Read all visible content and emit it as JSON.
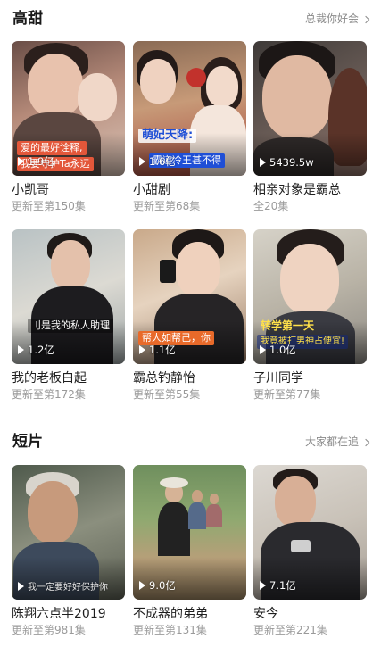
{
  "sections": [
    {
      "title": "高甜",
      "more": "总裁你好会",
      "items": [
        {
          "title": "小凯哥",
          "sub": "更新至第150集",
          "views": "1.9亿",
          "caption": "爱的最好诠释,",
          "caption2": "我要守护Ta永远"
        },
        {
          "title": "小甜剧",
          "sub": "更新至第68集",
          "views": "1.6亿",
          "caption": "萌妃天降:",
          "caption2": "霸道冷王甚不得"
        },
        {
          "title": "相亲对象是霸总",
          "sub": "全20集",
          "views": "5439.5w",
          "caption": "",
          "caption2": ""
        },
        {
          "title": "我的老板白起",
          "sub": "更新至第172集",
          "views": "1.2亿",
          "caption": "刂是我的私人助理",
          "caption2": ""
        },
        {
          "title": "霸总钓静怡",
          "sub": "更新至第55集",
          "views": "1.1亿",
          "caption": "帮人如帮己，你",
          "caption2": ""
        },
        {
          "title": "子川同学",
          "sub": "更新至第77集",
          "views": "1.0亿",
          "caption": "转学第一天",
          "caption2": "我竟被打男神占便宜!"
        }
      ]
    },
    {
      "title": "短片",
      "more": "大家都在追",
      "items": [
        {
          "title": "陈翔六点半2019",
          "sub": "更新至第981集",
          "views": "",
          "caption": "",
          "caption2": "我一定要好好保护你"
        },
        {
          "title": "不成器的弟弟",
          "sub": "更新至第131集",
          "views": "9.0亿",
          "caption": "",
          "caption2": ""
        },
        {
          "title": "安今",
          "sub": "更新至第221集",
          "views": "7.1亿",
          "caption": "",
          "caption2": ""
        }
      ]
    }
  ]
}
